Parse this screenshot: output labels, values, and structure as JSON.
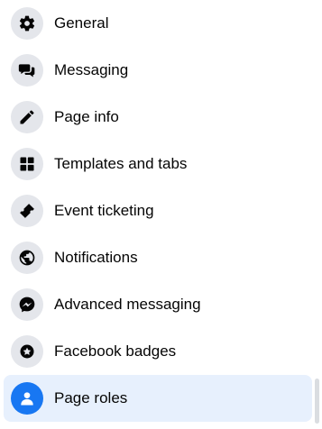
{
  "menu": {
    "items": [
      {
        "label": "General",
        "icon": "gear-icon",
        "selected": false
      },
      {
        "label": "Messaging",
        "icon": "chat-bubbles-icon",
        "selected": false
      },
      {
        "label": "Page info",
        "icon": "pencil-icon",
        "selected": false
      },
      {
        "label": "Templates and tabs",
        "icon": "grid-icon",
        "selected": false
      },
      {
        "label": "Event ticketing",
        "icon": "ticket-icon",
        "selected": false
      },
      {
        "label": "Notifications",
        "icon": "globe-icon",
        "selected": false
      },
      {
        "label": "Advanced messaging",
        "icon": "messenger-icon",
        "selected": false
      },
      {
        "label": "Facebook badges",
        "icon": "badge-star-icon",
        "selected": false
      },
      {
        "label": "Page roles",
        "icon": "person-icon",
        "selected": true
      }
    ]
  },
  "colors": {
    "icon_background": "#e4e6eb",
    "selected_background": "#e7f0fd",
    "selected_icon_background": "#1877f2",
    "text": "#050505"
  }
}
